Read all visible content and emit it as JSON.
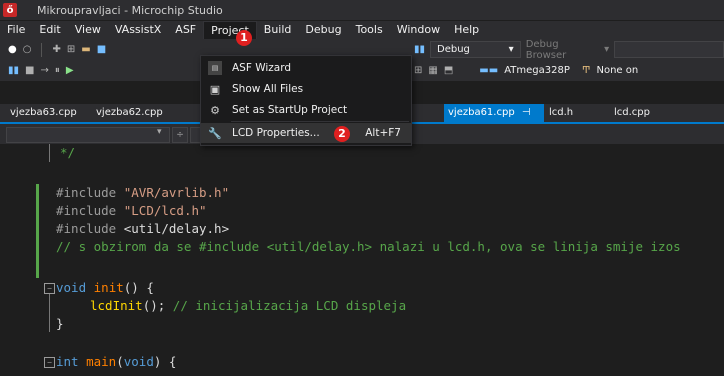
{
  "window": {
    "app_icon": "microchip-logo-icon",
    "title": "Mikroupravljaci - Microchip Studio"
  },
  "menubar": [
    "File",
    "Edit",
    "View",
    "VAssistX",
    "ASF",
    "Project",
    "Build",
    "Debug",
    "Tools",
    "Window",
    "Help"
  ],
  "toolbar": {
    "config": "Debug",
    "debug_browser": "Debug Browser",
    "device": "ATmega328P",
    "tool": "None on"
  },
  "tabs": {
    "left": [
      "vjezba63.cpp",
      "vjezba62.cpp"
    ],
    "active": "vjezba61.cpp",
    "pin_icon": "⊣",
    "close_icon": "✕",
    "right": [
      "lcd.h",
      "lcd.cpp"
    ]
  },
  "project_menu": [
    {
      "icon": "asf-wizard-icon",
      "label": "ASF Wizard",
      "shortcut": ""
    },
    {
      "icon": "show-all-files-icon",
      "label": "Show All Files",
      "shortcut": ""
    },
    {
      "icon": "gear-icon",
      "label": "Set as StartUp Project",
      "shortcut": ""
    },
    {
      "icon": "wrench-icon",
      "label": "LCD Properties...",
      "shortcut": "Alt+F7"
    }
  ],
  "markers": [
    "1",
    "2"
  ],
  "code": {
    "l0": "*/",
    "inc1_kw": "#include",
    "inc1_str": "\"AVR/avrlib.h\"",
    "inc2_kw": "#include",
    "inc2_str": "\"LCD/lcd.h\"",
    "inc3_kw": "#include",
    "inc3_str": "<util/delay.h>",
    "comment1": "// s obzirom da se #include <util/delay.h> nalazi u lcd.h, ova se linija smije izos",
    "init_kw": "void",
    "init_fn": "init",
    "init_rest": "() {",
    "lcd_call": "lcdInit",
    "lcd_rest": "();",
    "lcd_comment": "// inicijalizacija LCD displeja",
    "close_brace": "}",
    "main_kw": "int",
    "main_fn": "main",
    "main_open": "(",
    "main_arg": "void",
    "main_rest": ") {"
  }
}
